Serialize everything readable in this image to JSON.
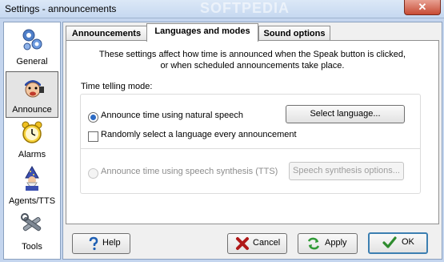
{
  "window": {
    "title": "Settings - announcements",
    "watermark": "SOFTPEDIA",
    "close_glyph": "✕"
  },
  "sidebar": {
    "items": [
      {
        "label": "General",
        "icon": "gears-icon",
        "selected": false
      },
      {
        "label": "Announce",
        "icon": "announcer-man-icon",
        "selected": true
      },
      {
        "label": "Alarms",
        "icon": "alarm-clock-icon",
        "selected": false
      },
      {
        "label": "Agents/TTS",
        "icon": "wizard-agent-icon",
        "selected": false
      },
      {
        "label": "Tools",
        "icon": "tools-icon",
        "selected": false
      }
    ]
  },
  "tabs": [
    {
      "label": "Announcements",
      "active": false
    },
    {
      "label": "Languages and modes",
      "active": true
    },
    {
      "label": "Sound options",
      "active": false
    }
  ],
  "panel": {
    "description_line1": "These settings affect how time is announced when the Speak button is clicked,",
    "description_line2": "or when scheduled announcements take place.",
    "mode_label": "Time telling mode:",
    "natural_speech_label": "Announce time using natural speech",
    "natural_speech_selected": true,
    "select_language_button": "Select language...",
    "random_language_label": "Randomly select a language every announcement",
    "random_language_checked": false,
    "tts_label": "Announce time using speech synthesis (TTS)",
    "tts_selected": false,
    "tts_options_button": "Speech synthesis options..."
  },
  "footer": {
    "help_button": "Help",
    "cancel_button": "Cancel",
    "apply_button": "Apply",
    "ok_button": "OK"
  },
  "colors": {
    "accent": "#3c7fb1",
    "window_bg": "#c4d5ee",
    "cancel_red": "#b01818",
    "apply_green": "#2f9a36",
    "ok_green": "#2e8b2e"
  }
}
